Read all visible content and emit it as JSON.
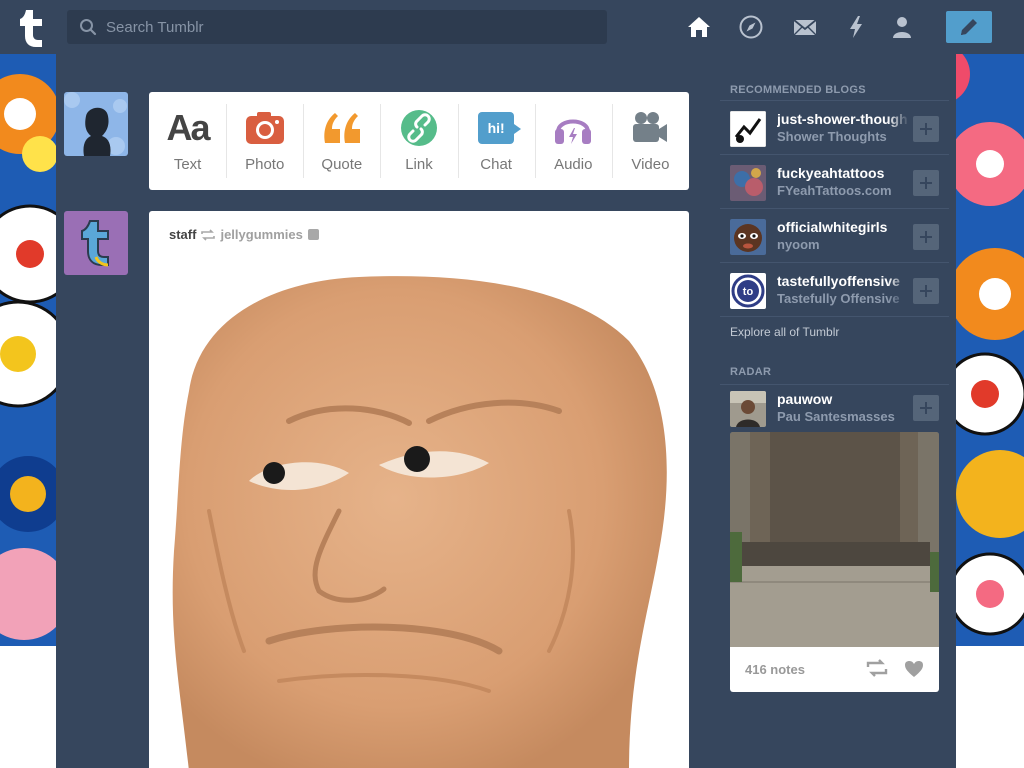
{
  "search": {
    "placeholder": "Search Tumblr"
  },
  "nav": {
    "icons": [
      "home-icon",
      "explore-compass-icon",
      "inbox-envelope-icon",
      "activity-lightning-icon",
      "account-person-icon",
      "compose-pencil-icon"
    ]
  },
  "post_types": [
    {
      "label": "Text",
      "icon": "text-aa-icon",
      "color": "#444444"
    },
    {
      "label": "Photo",
      "icon": "photo-camera-icon",
      "color": "#d95e40"
    },
    {
      "label": "Quote",
      "icon": "quote-icon",
      "color": "#f2992e"
    },
    {
      "label": "Link",
      "icon": "link-icon",
      "color": "#56bc8a"
    },
    {
      "label": "Chat",
      "icon": "chat-bubble-icon",
      "color": "#529ecc",
      "glyph": "hi!"
    },
    {
      "label": "Audio",
      "icon": "audio-headphones-icon",
      "color": "#a77dc2"
    },
    {
      "label": "Video",
      "icon": "video-camera-icon",
      "color": "#748089"
    }
  ],
  "post": {
    "author": "staff",
    "reblogged_from": "jellygummies"
  },
  "recommended": {
    "title": "RECOMMENDED BLOGS",
    "blogs": [
      {
        "name": "just-shower-thoughts",
        "subtitle": "Shower Thoughts"
      },
      {
        "name": "fuckyeahtattoos",
        "subtitle": "FYeahTattoos.com"
      },
      {
        "name": "officialwhitegirls",
        "subtitle": "nyoom"
      },
      {
        "name": "tastefullyoffensive",
        "subtitle": "Tastefully Offensive"
      }
    ],
    "explore_link": "Explore all of Tumblr"
  },
  "radar": {
    "title": "RADAR",
    "blog": {
      "name": "pauwow",
      "subtitle": "Pau Santesmasses"
    },
    "notes": "416 notes"
  },
  "colors": {
    "nav_bg": "#36465d",
    "dash_bg": "#36465d",
    "accent_blue": "#529ecc",
    "search_bg": "#2d3b4f"
  }
}
